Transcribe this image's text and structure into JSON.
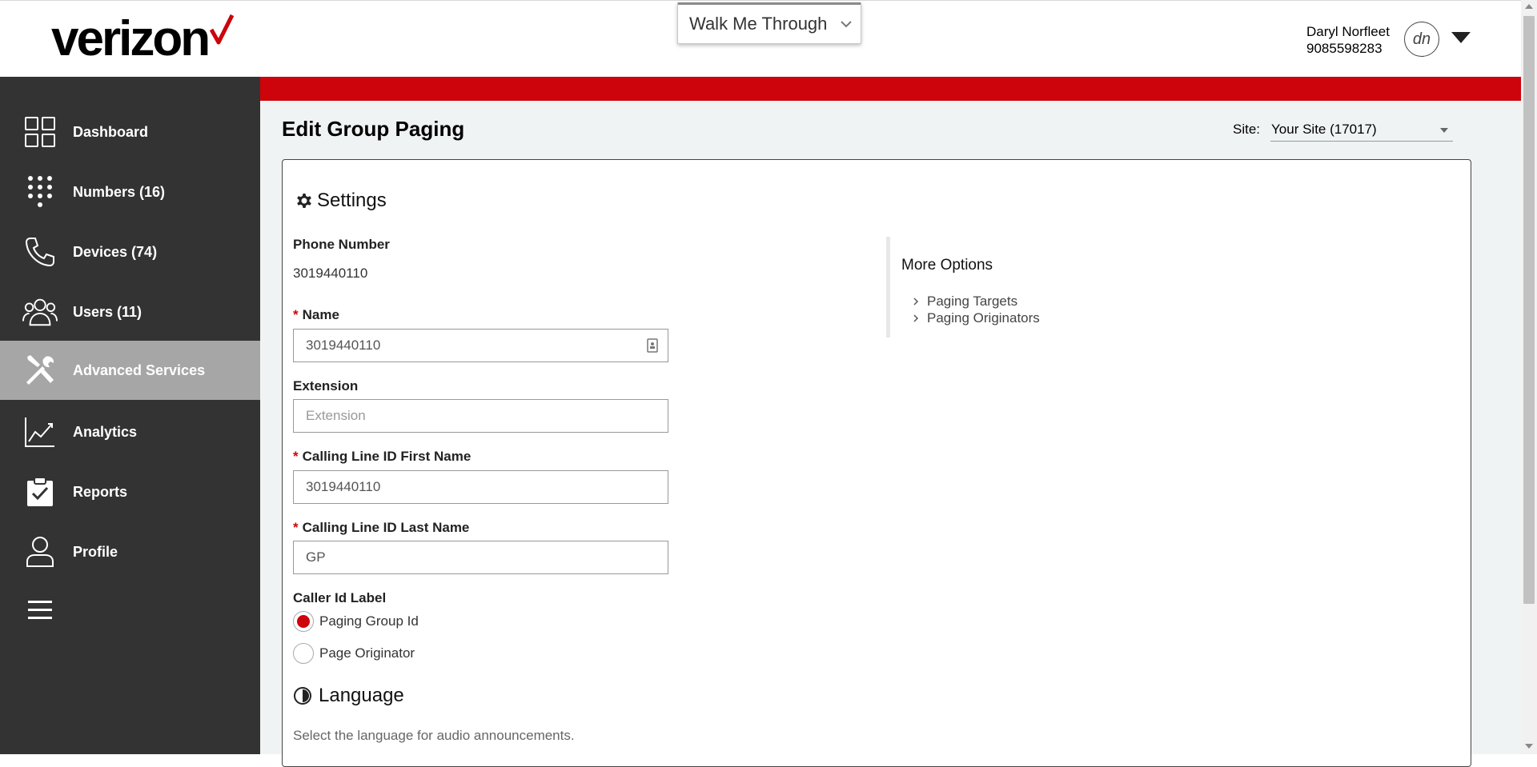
{
  "brand": {
    "logo_text": "verizon",
    "accent": "#cd040b"
  },
  "header": {
    "walkme_label": "Walk Me Through",
    "user_name": "Daryl Norfleet",
    "user_phone": "9085598283",
    "avatar_initials": "dn"
  },
  "sidebar": {
    "items": [
      {
        "label": "Dashboard",
        "icon": "grid-icon",
        "active": false
      },
      {
        "label": "Numbers (16)",
        "icon": "dialpad-icon",
        "active": false
      },
      {
        "label": "Devices (74)",
        "icon": "phone-icon",
        "active": false
      },
      {
        "label": "Users (11)",
        "icon": "users-icon",
        "active": false
      },
      {
        "label": "Advanced Services",
        "icon": "tools-icon",
        "active": true
      },
      {
        "label": "Analytics",
        "icon": "chart-icon",
        "active": false
      },
      {
        "label": "Reports",
        "icon": "clipboard-check-icon",
        "active": false
      },
      {
        "label": "Profile",
        "icon": "person-icon",
        "active": false
      },
      {
        "label": "",
        "icon": "hamburger-menu-icon",
        "active": false
      }
    ]
  },
  "main": {
    "title": "Edit Group Paging",
    "site_label": "Site:",
    "site_value": "Your Site (17017)"
  },
  "settings": {
    "title": "Settings",
    "phone_number_label": "Phone Number",
    "phone_number_value": "3019440110",
    "name_label": "Name",
    "name_value": "3019440110",
    "extension_label": "Extension",
    "extension_placeholder": "Extension",
    "clid_first_label": "Calling Line ID First Name",
    "clid_first_value": "3019440110",
    "clid_last_label": "Calling Line ID Last Name",
    "clid_last_value": "GP",
    "caller_id_label": "Caller Id Label",
    "caller_id_options": [
      {
        "label": "Paging Group Id",
        "selected": true
      },
      {
        "label": "Page Originator",
        "selected": false
      }
    ]
  },
  "more_options": {
    "title": "More Options",
    "links": [
      "Paging Targets",
      "Paging Originators"
    ]
  },
  "language": {
    "title": "Language",
    "description": "Select the language for audio announcements."
  }
}
